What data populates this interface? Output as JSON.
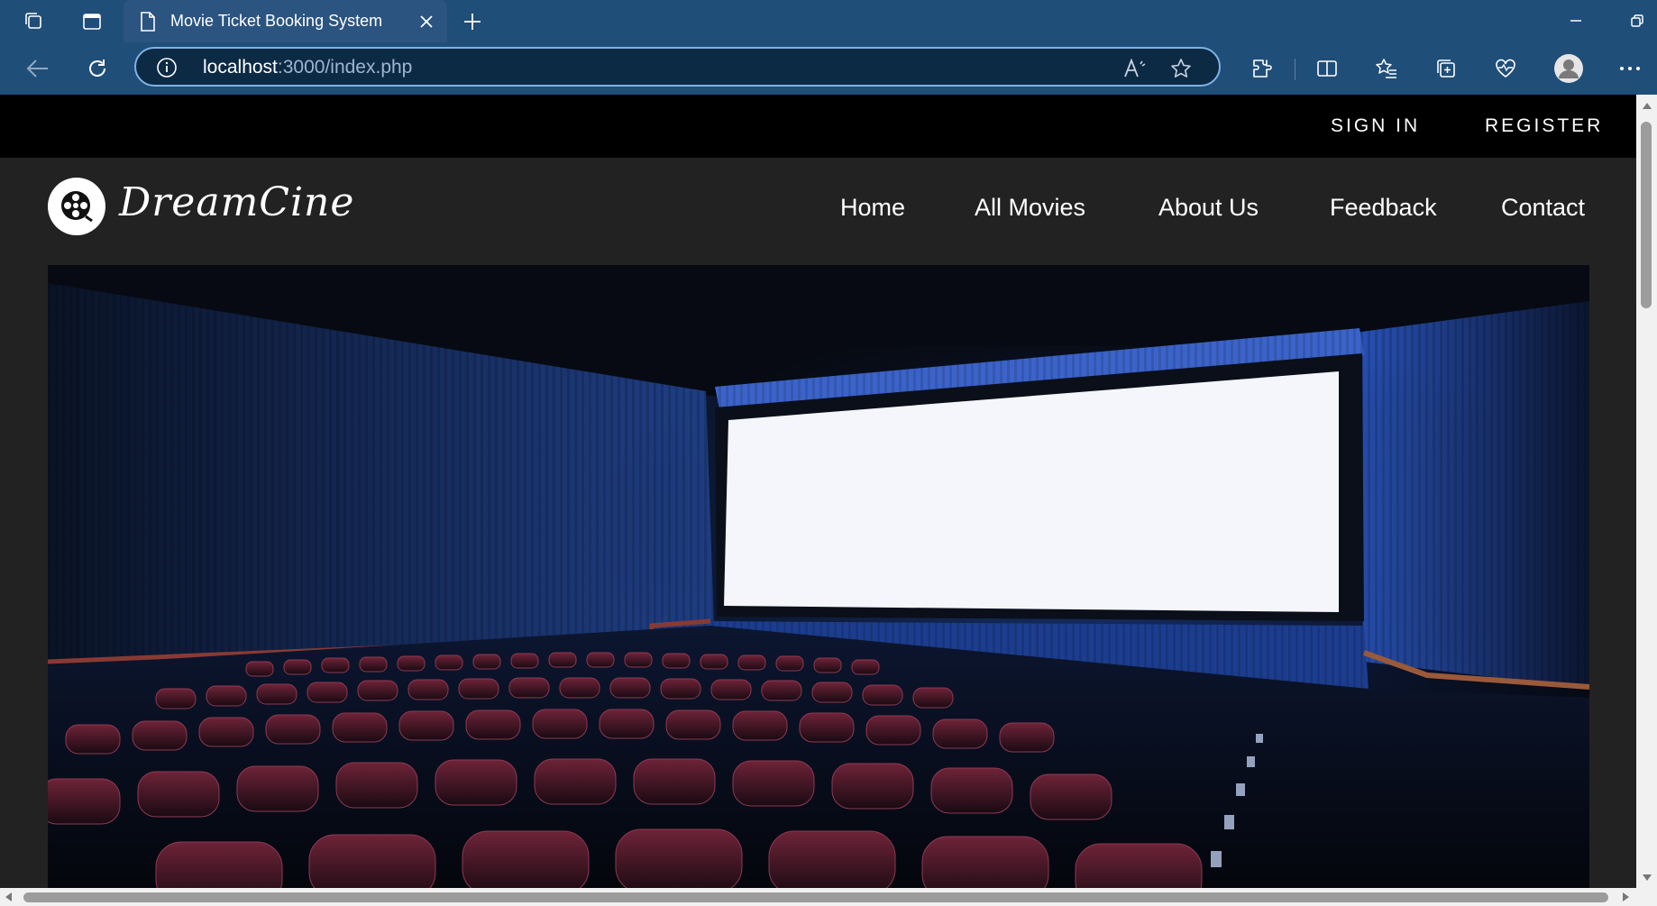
{
  "browser": {
    "tab_title": "Movie Ticket Booking System",
    "url_host": "localhost",
    "url_rest": ":3000/index.php"
  },
  "topbar": {
    "sign_in": "SIGN IN",
    "register": "REGISTER"
  },
  "header": {
    "logo_text": "DreamCine",
    "nav": [
      {
        "label": "Home"
      },
      {
        "label": "All Movies"
      },
      {
        "label": "About Us"
      },
      {
        "label": "Feedback"
      },
      {
        "label": "Contact"
      }
    ]
  },
  "colors": {
    "chrome": "#1f4e79",
    "page_bg": "#222222",
    "topbar_bg": "#000000",
    "screen_glow": "#2a5cc7"
  }
}
